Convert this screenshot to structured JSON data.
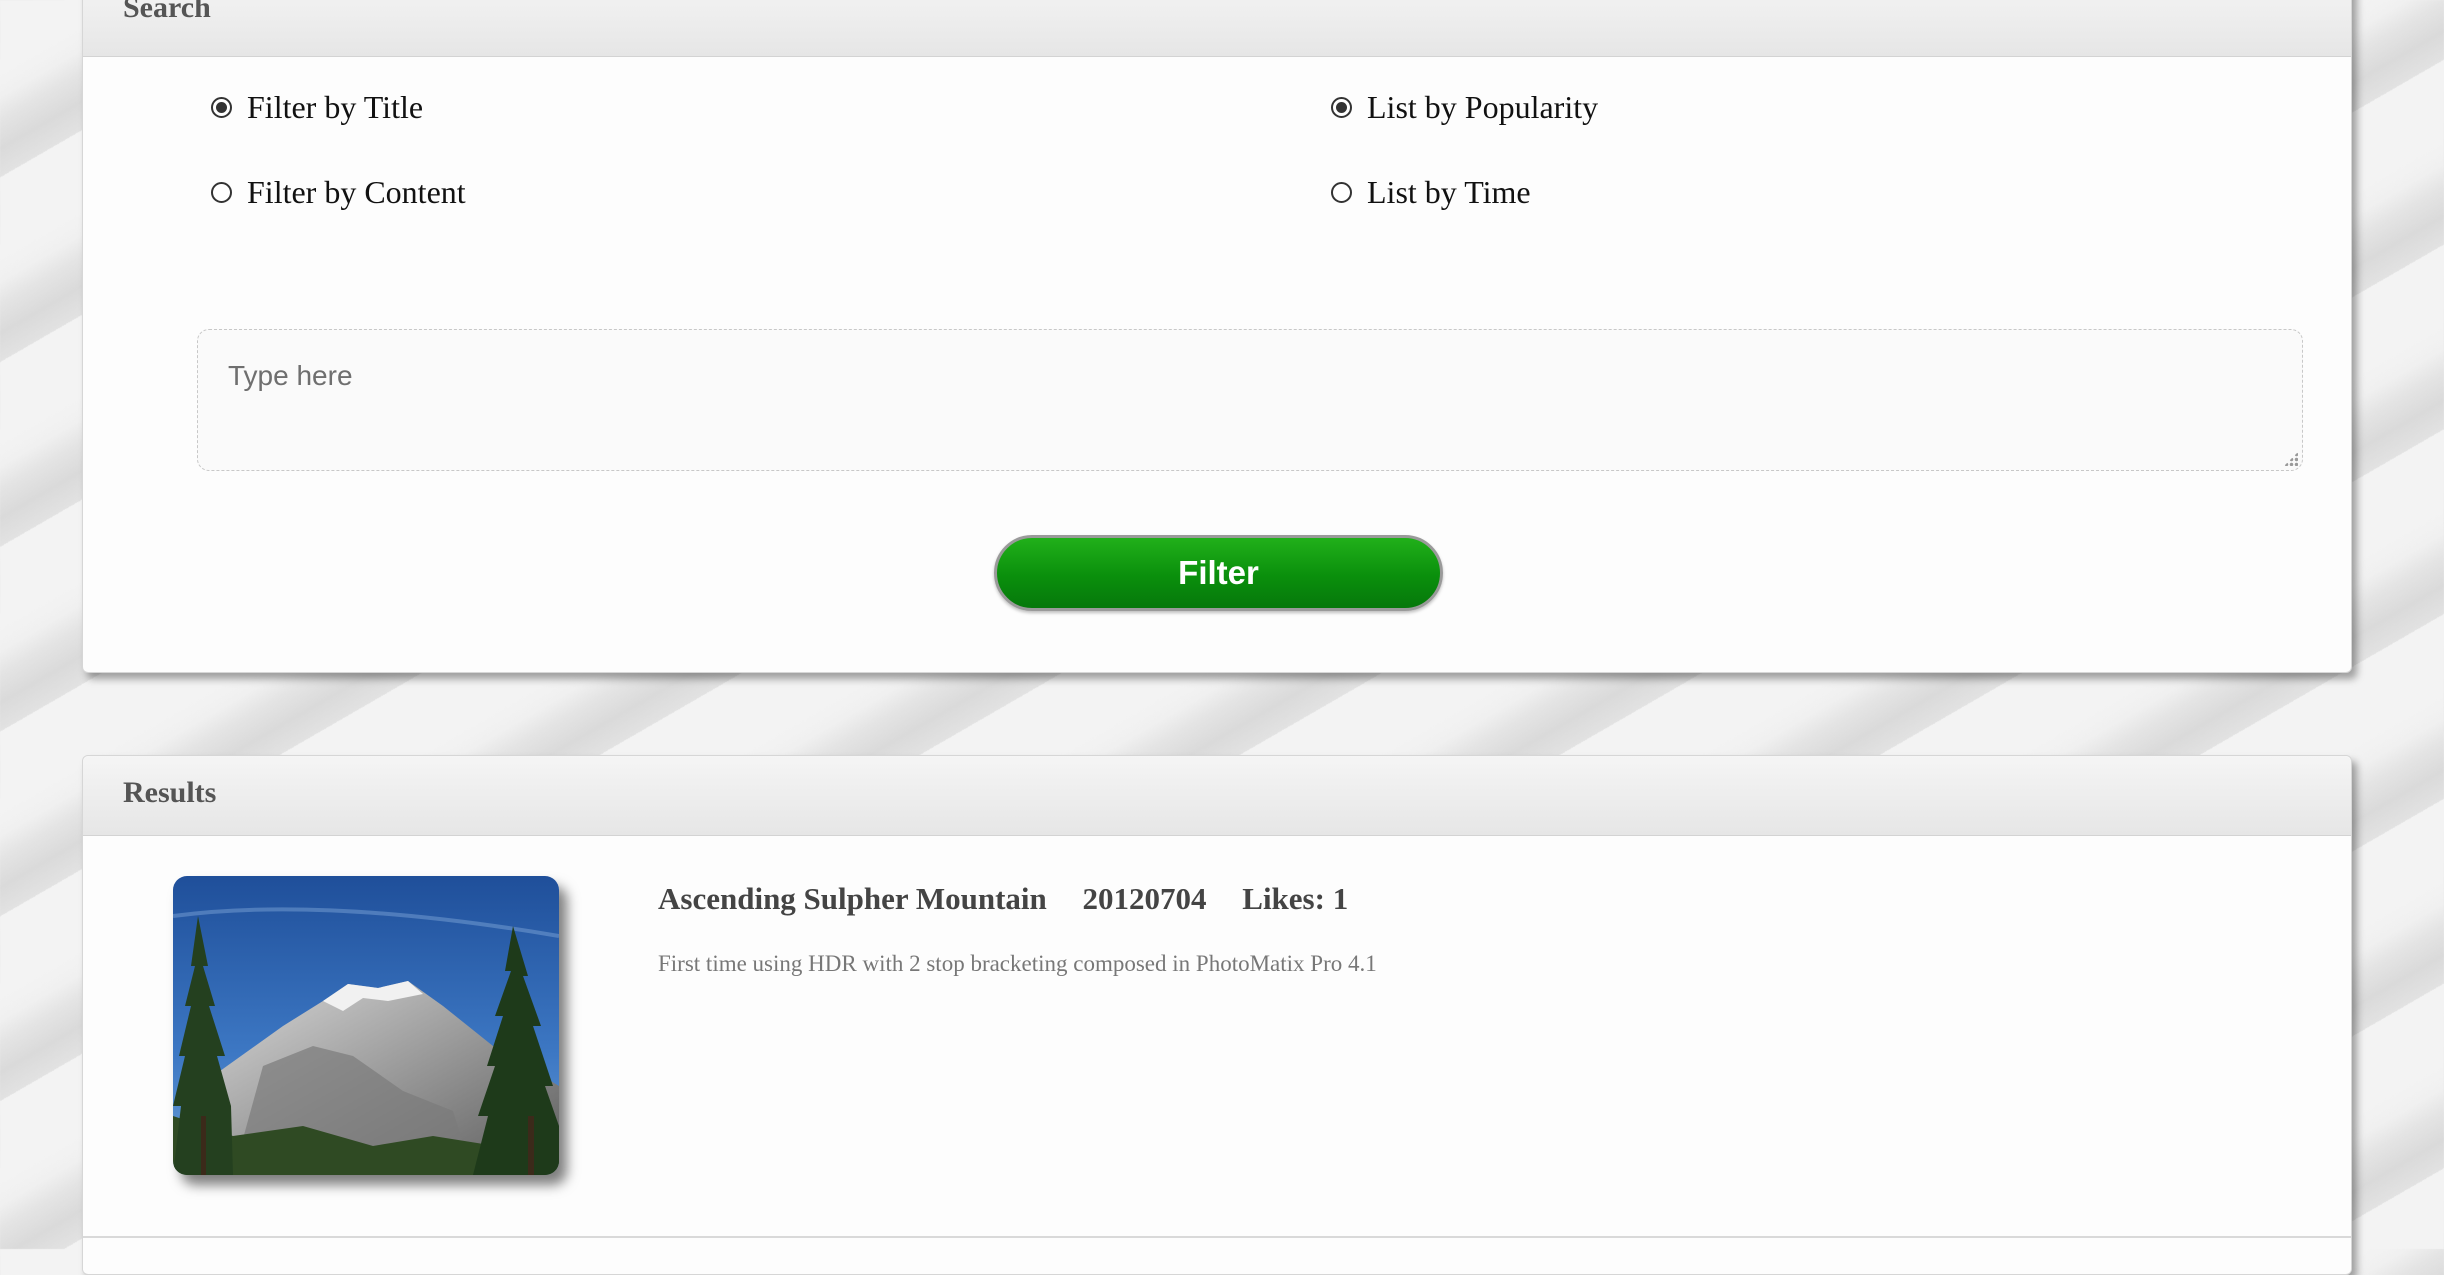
{
  "search": {
    "title": "Search",
    "filter_options": [
      {
        "label": "Filter by Title",
        "checked": true
      },
      {
        "label": "Filter by Content",
        "checked": false
      }
    ],
    "list_options": [
      {
        "label": "List by Popularity",
        "checked": true
      },
      {
        "label": "List by Time",
        "checked": false
      }
    ],
    "input_placeholder": "Type here",
    "filter_button_label": "Filter",
    "button_color": "#0a8f0c"
  },
  "results": {
    "title": "Results",
    "items": [
      {
        "title": "Ascending Sulpher Mountain",
        "date": "20120704",
        "likes": "Likes: 1",
        "description": "First time using HDR with 2 stop bracketing composed in PhotoMatix Pro 4.1",
        "thumbnail": "mountain-photo"
      }
    ]
  }
}
